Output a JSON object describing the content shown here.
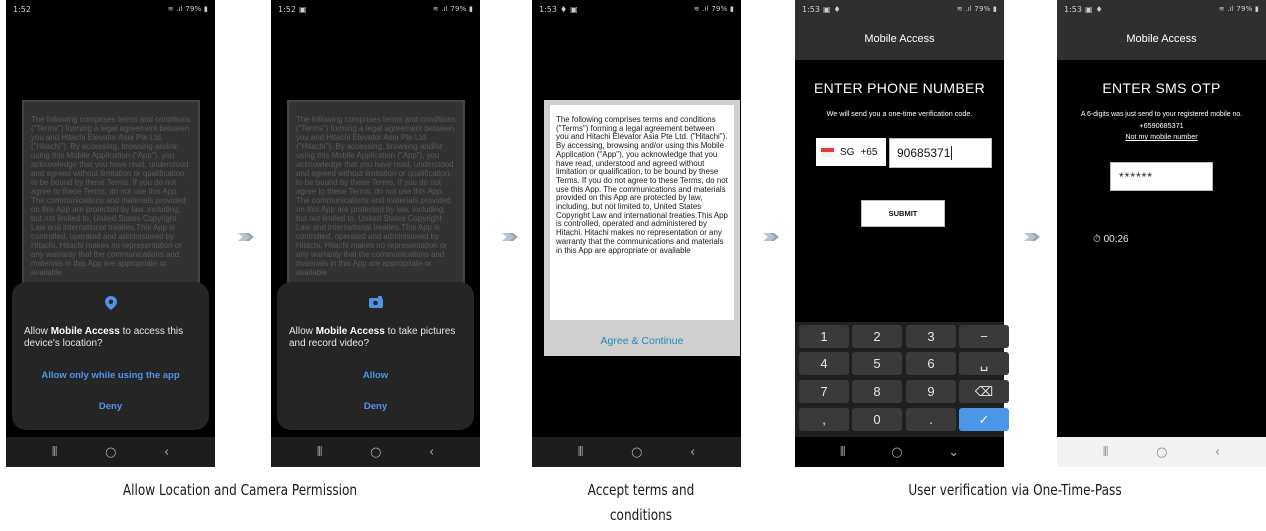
{
  "terms_text": "The following comprises terms and conditions (\"Terms\") forming a legal agreement between you and Hitachi Elevator Asia Pte Ltd. (\"Hitachi\"). By accessing, browsing and/or using this Mobile Application (\"App\"), you acknowledge that you have read, understood and agreed without limitation or qualification, to be bound by these Terms. If you do not agree to these Terms, do not use this App. The communications and materials provided on this App are protected by law, including, but not limited to, United States Copyright Law and international treaties.This App is controlled, operated and administered by Hitachi. Hitachi makes no representation or any warranty that the communications and materials in this App are appropriate or available",
  "phone1": {
    "time": "1:52",
    "signal": "79%",
    "dialog": {
      "msg_prefix": "Allow ",
      "app_name": "Mobile Access",
      "msg_suffix": " to access this device's location?",
      "primary_label": "Allow only while using the app",
      "deny_label": "Deny"
    }
  },
  "phone2": {
    "time": "1:52",
    "signal": "79%",
    "dialog": {
      "msg_prefix": "Allow ",
      "app_name": "Mobile Access",
      "msg_suffix": " to take pictures and record video?",
      "primary_label": "Allow",
      "deny_label": "Deny"
    }
  },
  "phone3": {
    "time": "1:53",
    "signal": "79%",
    "agree_label": "Agree & Continue"
  },
  "phone4": {
    "time": "1:53",
    "signal": "79%",
    "app_title": "Mobile Access",
    "heading": "ENTER PHONE NUMBER",
    "subtext": "We will send you a one-time verification code.",
    "country_code": "SG",
    "dial_code": "+65",
    "phone_value": "90685371",
    "submit_label": "SUBMIT",
    "keys": [
      "1",
      "2",
      "3",
      "−",
      "4",
      "5",
      "6",
      "␣",
      "7",
      "8",
      "9",
      "⌫",
      ",",
      "0",
      ".",
      "✓"
    ]
  },
  "phone5": {
    "time": "1:53",
    "signal": "79%",
    "app_title": "Mobile Access",
    "heading": "ENTER SMS OTP",
    "subtext": "A 6-digits was just send to your registered mobile no.",
    "phone_number": "+6590685371",
    "not_my_number": "Not my mobile number",
    "otp_value": "******",
    "timer": "00:26"
  },
  "captions": {
    "permissions": "Allow Location and Camera Permission",
    "terms_line1": "Accept terms and",
    "terms_line2": "conditions",
    "otp": "User verification via One-Time-Pass"
  },
  "colors": {
    "dialog_button": "#4f94e8",
    "agree_text": "#1f8db5",
    "keypad_done": "#4b96e6"
  }
}
